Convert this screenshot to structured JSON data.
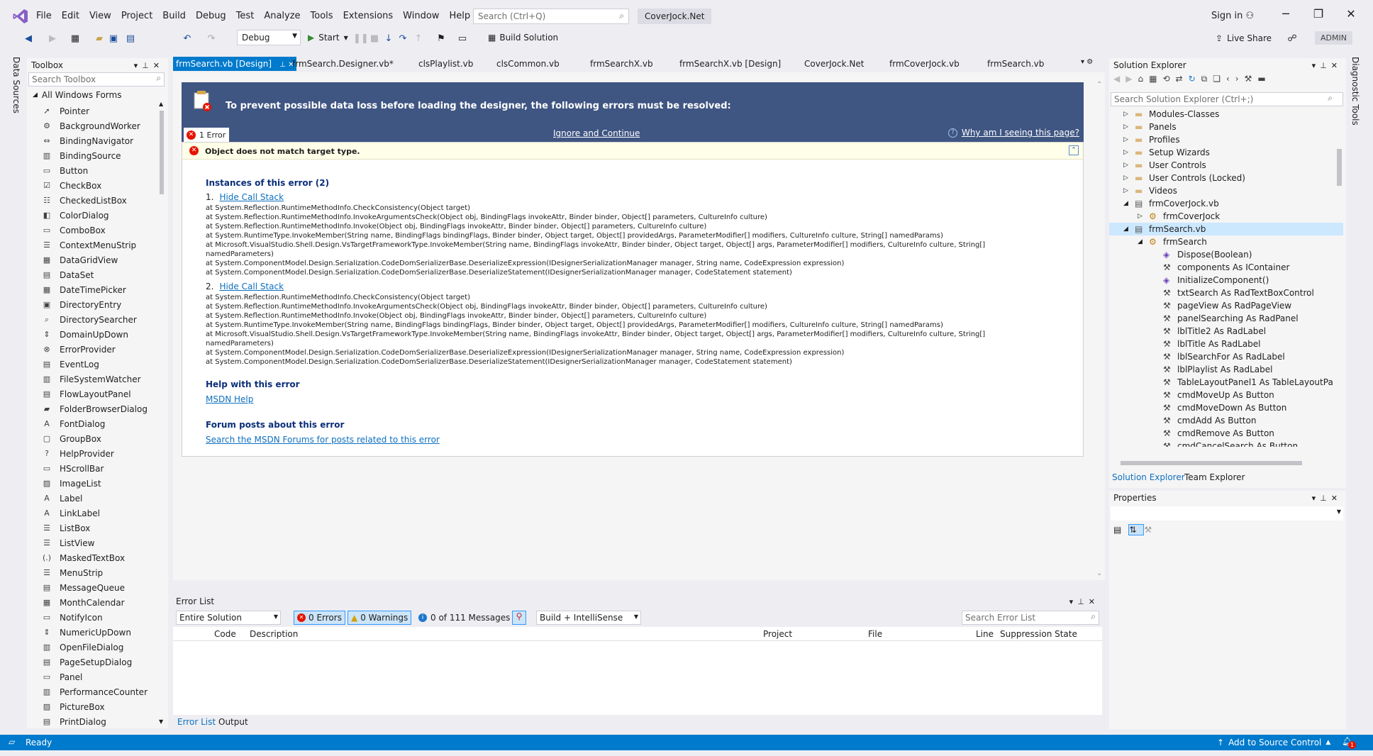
{
  "app": {
    "logo": "visual-studio-logo",
    "search_placeholder": "Search (Ctrl+Q)",
    "solution_name": "CoverJock.Net",
    "sign_in": "Sign in",
    "live_share": "Live Share",
    "admin": "ADMIN"
  },
  "menu": [
    "File",
    "Edit",
    "View",
    "Project",
    "Build",
    "Debug",
    "Test",
    "Analyze",
    "Tools",
    "Extensions",
    "Window",
    "Help"
  ],
  "toolbar": {
    "config": "Debug",
    "start": "Start",
    "build_solution": "Build Solution"
  },
  "left_strip": {
    "label": "Data Sources"
  },
  "right_strip": {
    "label": "Diagnostic Tools"
  },
  "toolbox": {
    "title": "Toolbox",
    "search_placeholder": "Search Toolbox",
    "group": "All Windows Forms",
    "items": [
      "Pointer",
      "BackgroundWorker",
      "BindingNavigator",
      "BindingSource",
      "Button",
      "CheckBox",
      "CheckedListBox",
      "ColorDialog",
      "ComboBox",
      "ContextMenuStrip",
      "DataGridView",
      "DataSet",
      "DateTimePicker",
      "DirectoryEntry",
      "DirectorySearcher",
      "DomainUpDown",
      "ErrorProvider",
      "EventLog",
      "FileSystemWatcher",
      "FlowLayoutPanel",
      "FolderBrowserDialog",
      "FontDialog",
      "GroupBox",
      "HelpProvider",
      "HScrollBar",
      "ImageList",
      "Label",
      "LinkLabel",
      "ListBox",
      "ListView",
      "MaskedTextBox",
      "MenuStrip",
      "MessageQueue",
      "MonthCalendar",
      "NotifyIcon",
      "NumericUpDown",
      "OpenFileDialog",
      "PageSetupDialog",
      "Panel",
      "PerformanceCounter",
      "PictureBox",
      "PrintDialog"
    ]
  },
  "tabs": [
    "frmSearch.vb [Design]",
    "frmSearch.Designer.vb*",
    "clsPlaylist.vb",
    "clsCommon.vb",
    "frmSearchX.vb",
    "frmSearchX.vb [Design]",
    "CoverJock.Net",
    "frmCoverJock.vb",
    "frmSearch.vb"
  ],
  "designer_error": {
    "header": "To prevent possible data loss before loading the designer, the following errors must be resolved:",
    "error_count": "1 Error",
    "ignore": "Ignore and Continue",
    "why": "Why am I seeing this page?",
    "message": "Object does not match target type.",
    "instances_title": "Instances of this error (2)",
    "instances": [
      {
        "num": "1.",
        "link": "Hide Call Stack",
        "stack": [
          "at System.Reflection.RuntimeMethodInfo.CheckConsistency(Object target)",
          "at System.Reflection.RuntimeMethodInfo.InvokeArgumentsCheck(Object obj, BindingFlags invokeAttr, Binder binder, Object[] parameters, CultureInfo culture)",
          "at System.Reflection.RuntimeMethodInfo.Invoke(Object obj, BindingFlags invokeAttr, Binder binder, Object[] parameters, CultureInfo culture)",
          "at System.RuntimeType.InvokeMember(String name, BindingFlags bindingFlags, Binder binder, Object target, Object[] providedArgs, ParameterModifier[] modifiers, CultureInfo culture, String[] namedParams)",
          "at Microsoft.VisualStudio.Shell.Design.VsTargetFrameworkType.InvokeMember(String name, BindingFlags invokeAttr, Binder binder, Object target, Object[] args, ParameterModifier[] modifiers, CultureInfo culture, String[]",
          "namedParameters)",
          "at System.ComponentModel.Design.Serialization.CodeDomSerializerBase.DeserializeExpression(IDesignerSerializationManager manager, String name, CodeExpression expression)",
          "at System.ComponentModel.Design.Serialization.CodeDomSerializerBase.DeserializeStatement(IDesignerSerializationManager manager, CodeStatement statement)"
        ]
      },
      {
        "num": "2.",
        "link": "Hide Call Stack",
        "stack": [
          "at System.Reflection.RuntimeMethodInfo.CheckConsistency(Object target)",
          "at System.Reflection.RuntimeMethodInfo.InvokeArgumentsCheck(Object obj, BindingFlags invokeAttr, Binder binder, Object[] parameters, CultureInfo culture)",
          "at System.Reflection.RuntimeMethodInfo.Invoke(Object obj, BindingFlags invokeAttr, Binder binder, Object[] parameters, CultureInfo culture)",
          "at System.RuntimeType.InvokeMember(String name, BindingFlags bindingFlags, Binder binder, Object target, Object[] providedArgs, ParameterModifier[] modifiers, CultureInfo culture, String[] namedParams)",
          "at Microsoft.VisualStudio.Shell.Design.VsTargetFrameworkType.InvokeMember(String name, BindingFlags invokeAttr, Binder binder, Object target, Object[] args, ParameterModifier[] modifiers, CultureInfo culture, String[]",
          "namedParameters)",
          "at System.ComponentModel.Design.Serialization.CodeDomSerializerBase.DeserializeExpression(IDesignerSerializationManager manager, String name, CodeExpression expression)",
          "at System.ComponentModel.Design.Serialization.CodeDomSerializerBase.DeserializeStatement(IDesignerSerializationManager manager, CodeStatement statement)"
        ]
      }
    ],
    "help_title": "Help with this error",
    "help_link": "MSDN Help",
    "forum_title": "Forum posts about this error",
    "forum_link": "Search the MSDN Forums for posts related to this error"
  },
  "error_list": {
    "title": "Error List",
    "scope": "Entire Solution",
    "errors": "0 Errors",
    "warnings": "0 Warnings",
    "messages": "0 of 111 Messages",
    "build": "Build + IntelliSense",
    "search_placeholder": "Search Error List",
    "columns": [
      "Code",
      "Description",
      "Project",
      "File",
      "Line",
      "Suppression State"
    ],
    "bottom_tabs": [
      "Error List",
      "Output"
    ]
  },
  "solution_explorer": {
    "title": "Solution Explorer",
    "search_placeholder": "Search Solution Explorer (Ctrl+;)",
    "nodes": [
      {
        "label": "Modules-Classes",
        "kind": "folder",
        "level": 1,
        "arrow": "collapsed"
      },
      {
        "label": "Panels",
        "kind": "folder",
        "level": 1,
        "arrow": "collapsed"
      },
      {
        "label": "Profiles",
        "kind": "folder",
        "level": 1,
        "arrow": "collapsed"
      },
      {
        "label": "Setup Wizards",
        "kind": "folder",
        "level": 1,
        "arrow": "collapsed"
      },
      {
        "label": "User Controls",
        "kind": "folder",
        "level": 1,
        "arrow": "collapsed"
      },
      {
        "label": "User Controls (Locked)",
        "kind": "folder",
        "level": 1,
        "arrow": "collapsed"
      },
      {
        "label": "Videos",
        "kind": "folder",
        "level": 1,
        "arrow": "collapsed"
      },
      {
        "label": "frmCoverJock.vb",
        "kind": "form",
        "level": 1,
        "arrow": "expanded"
      },
      {
        "label": "frmCoverJock",
        "kind": "class",
        "level": 2,
        "arrow": "collapsed"
      },
      {
        "label": "frmSearch.vb",
        "kind": "form",
        "level": 1,
        "arrow": "expanded",
        "selected": true
      },
      {
        "label": "frmSearch",
        "kind": "class",
        "level": 2,
        "arrow": "expanded"
      },
      {
        "label": "Dispose(Boolean)",
        "kind": "method",
        "level": 3
      },
      {
        "label": "components As IContainer",
        "kind": "field",
        "level": 3
      },
      {
        "label": "InitializeComponent()",
        "kind": "method",
        "level": 3
      },
      {
        "label": "txtSearch As RadTextBoxControl",
        "kind": "field",
        "level": 3
      },
      {
        "label": "pageView As RadPageView",
        "kind": "field",
        "level": 3
      },
      {
        "label": "panelSearching As RadPanel",
        "kind": "field",
        "level": 3
      },
      {
        "label": "lblTitle2 As RadLabel",
        "kind": "field",
        "level": 3
      },
      {
        "label": "lblTitle As RadLabel",
        "kind": "field",
        "level": 3
      },
      {
        "label": "lblSearchFor As RadLabel",
        "kind": "field",
        "level": 3
      },
      {
        "label": "lblPlaylist As RadLabel",
        "kind": "field",
        "level": 3
      },
      {
        "label": "TableLayoutPanel1 As TableLayoutPa",
        "kind": "field",
        "level": 3
      },
      {
        "label": "cmdMoveUp As Button",
        "kind": "field",
        "level": 3
      },
      {
        "label": "cmdMoveDown As Button",
        "kind": "field",
        "level": 3
      },
      {
        "label": "cmdAdd As Button",
        "kind": "field",
        "level": 3
      },
      {
        "label": "cmdRemove As Button",
        "kind": "field",
        "level": 3
      },
      {
        "label": "cmdCancelSearch As Button",
        "kind": "field",
        "level": 3
      }
    ],
    "bottom_tabs": [
      "Solution Explorer",
      "Team Explorer"
    ]
  },
  "properties": {
    "title": "Properties"
  },
  "status": {
    "ready": "Ready",
    "source_control": "Add to Source Control",
    "notifications": "1"
  },
  "colors": {
    "accent": "#007acc",
    "error_header": "#3f5582",
    "error_red": "#e51400",
    "link": "#0e70c0"
  }
}
